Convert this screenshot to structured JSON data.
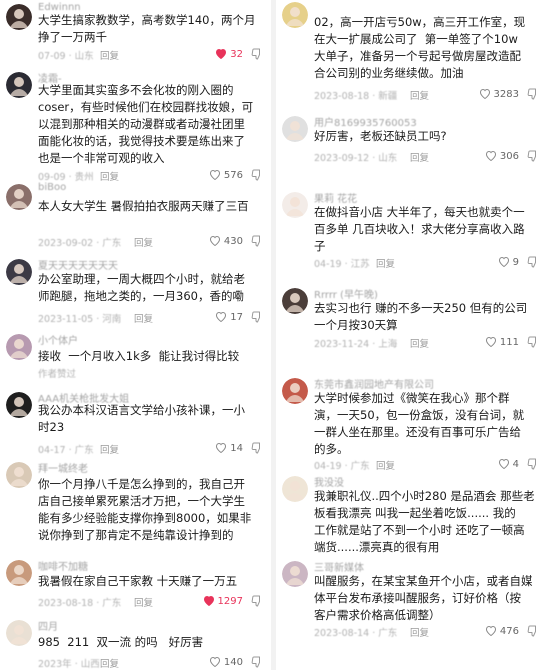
{
  "icons": {
    "like": "heart-icon",
    "dislike": "thumbs-down-icon",
    "reply": "reply-button"
  },
  "colors": {
    "liked": "#e8335a",
    "meta": "#b3b3b3",
    "text": "#1a1a1a"
  },
  "left": [
    {
      "name": "Edwinnn",
      "lines": [
        "大学生搞家教数学，高考数学140，两个月",
        "挣了一万两千"
      ],
      "date": "07-09 · 山东",
      "reply": "回复",
      "likes": "32",
      "liked": true,
      "av": "#3a2d2a"
    },
    {
      "name": "凌霜-",
      "lines": [
        "大学里面其实蛮多不会化妆的刚入圈的",
        "coser，有些时候他们在校园群找妆娘，可",
        "以混到那种相关的动漫群或者动漫社团里",
        "面能化妆的话，我觉得技术要是练出来了",
        "也是一个非常可观的收入"
      ],
      "date": "09-09 · 贵州",
      "reply": "回复",
      "likes": "576",
      "liked": false,
      "av": "#2b2b33"
    },
    {
      "name": "biBoo",
      "lines": [
        "本人女大学生 暑假拍拍衣服两天赚了三百",
        ""
      ],
      "date": "2023-09-02 · 广东",
      "reply": "回复",
      "likes": "430",
      "liked": false,
      "av": "#8a6f6a"
    },
    {
      "name": "夏天天天天天天天",
      "lines": [
        "办公室助理，一周大概四个小时，就给老",
        "师跑腿，拖地之类的，一月360，香的嘞"
      ],
      "date": "2023-11-05 · 河南",
      "reply": "回复",
      "likes": "17",
      "liked": false,
      "av": "#3c3a45"
    },
    {
      "name": "小个体户",
      "lines": [
        "接收  一个月收入1k多  能让我讨得比较"
      ],
      "date": "作者赞过",
      "reply": "",
      "likes": "",
      "liked": false,
      "av": "#b79ab0"
    },
    {
      "name": "AAA机关枪批发大姐",
      "lines": [
        "我公办本科汉语言文学给小孩补课，一小",
        "时23"
      ],
      "date": "04-17 · 广东",
      "reply": "回复",
      "likes": "14",
      "liked": false,
      "av": "#1f1f1f"
    },
    {
      "name": "拜一城终老",
      "lines": [
        "你一个月挣八千是怎么挣到的，我自己开",
        "店自己接单累死累活才万把，一个大学生",
        "能有多少经验能支撑你挣到8000，如果非",
        "说你挣到了那肯定不是纯靠设计挣到的"
      ],
      "date": "",
      "reply": "",
      "likes": "",
      "liked": false,
      "av": "#d9c9b6"
    },
    {
      "name": "咖啡不加糖",
      "lines": [
        "我暑假在家自己干家教 十天赚了一万五"
      ],
      "date": "2023-08-18 · 广东",
      "reply": "回复",
      "likes": "1297",
      "liked": true,
      "av": "#c89a7c"
    },
    {
      "name": "四月",
      "lines": [
        "985  211  双一流 的吗   好厉害"
      ],
      "date": "2023年 · 山西",
      "reply": "回复",
      "likes": "140",
      "liked": false,
      "av": "#e9e0d4"
    }
  ],
  "right": [
    {
      "name": "",
      "lines": [
        "02，高一开店亏50w，高三开工作室，现",
        "在大一扩展成公司了  第一单签了个10w",
        "大单子，准备另一个号起号做房屋改造配",
        "合公司别的业务继续做。加油"
      ],
      "date": "2023-08-18 · 新疆",
      "reply": "回复",
      "likes": "3283",
      "liked": false,
      "av": "#e6d08a"
    },
    {
      "name": "用户8169935760053",
      "lines": [
        "好厉害，老板还缺员工吗?"
      ],
      "date": "2023-09-12 · 山东",
      "reply": "回复",
      "likes": "306",
      "liked": false,
      "av": "#e0e0e0"
    },
    {
      "name": "果莉 花花",
      "lines": [
        "在做抖音小店 大半年了，每天也就卖个一",
        "百多单 几百块收入！求大佬分享高收入路",
        "子"
      ],
      "date": "04-19 · 江苏",
      "reply": "回复",
      "likes": "9",
      "liked": false,
      "av": "#f3ece8"
    },
    {
      "name": "Rrrrr (早午晚)",
      "lines": [
        "去实习也行 赚的不多一天250 但有的公司",
        "一个月按30天算"
      ],
      "date": "2023-11-24 · 上海",
      "reply": "回复",
      "likes": "111",
      "liked": false,
      "av": "#4b3e3a"
    },
    {
      "name": "东莞市鑫润园地产有限公司",
      "lines": [
        "大学时候参加过《微笑在我心》那个群",
        "演，一天50，包一份盒饭，没有台词，就",
        "一群人坐在那里。还没有百事可乐广告给",
        "的多。"
      ],
      "date": "04-19 · 广东",
      "reply": "回复",
      "likes": "4",
      "liked": false,
      "av": "#c45a4a"
    },
    {
      "name": "我没没",
      "lines": [
        "我兼职礼仪..四个小时280 是品酒会 那些老",
        "板看我漂亮 叫我一起坐着吃饭...... 我的",
        "工作就是站了不到一个小时 还吃了一顿高",
        "端货......漂亮真的很有用"
      ],
      "date": "",
      "reply": "",
      "likes": "",
      "liked": false,
      "av": "#efe5d6"
    },
    {
      "name": "三哥新媒体",
      "lines": [
        "叫醒服务，在某宝某鱼开个小店，或者自媒",
        "体平台发布承接叫醒服务，订好价格（按",
        "客户需求价格高低调整）"
      ],
      "date": "2023-08-14 · 广东",
      "reply": "回复",
      "likes": "476",
      "liked": false,
      "av": "#cbb6c3"
    }
  ]
}
